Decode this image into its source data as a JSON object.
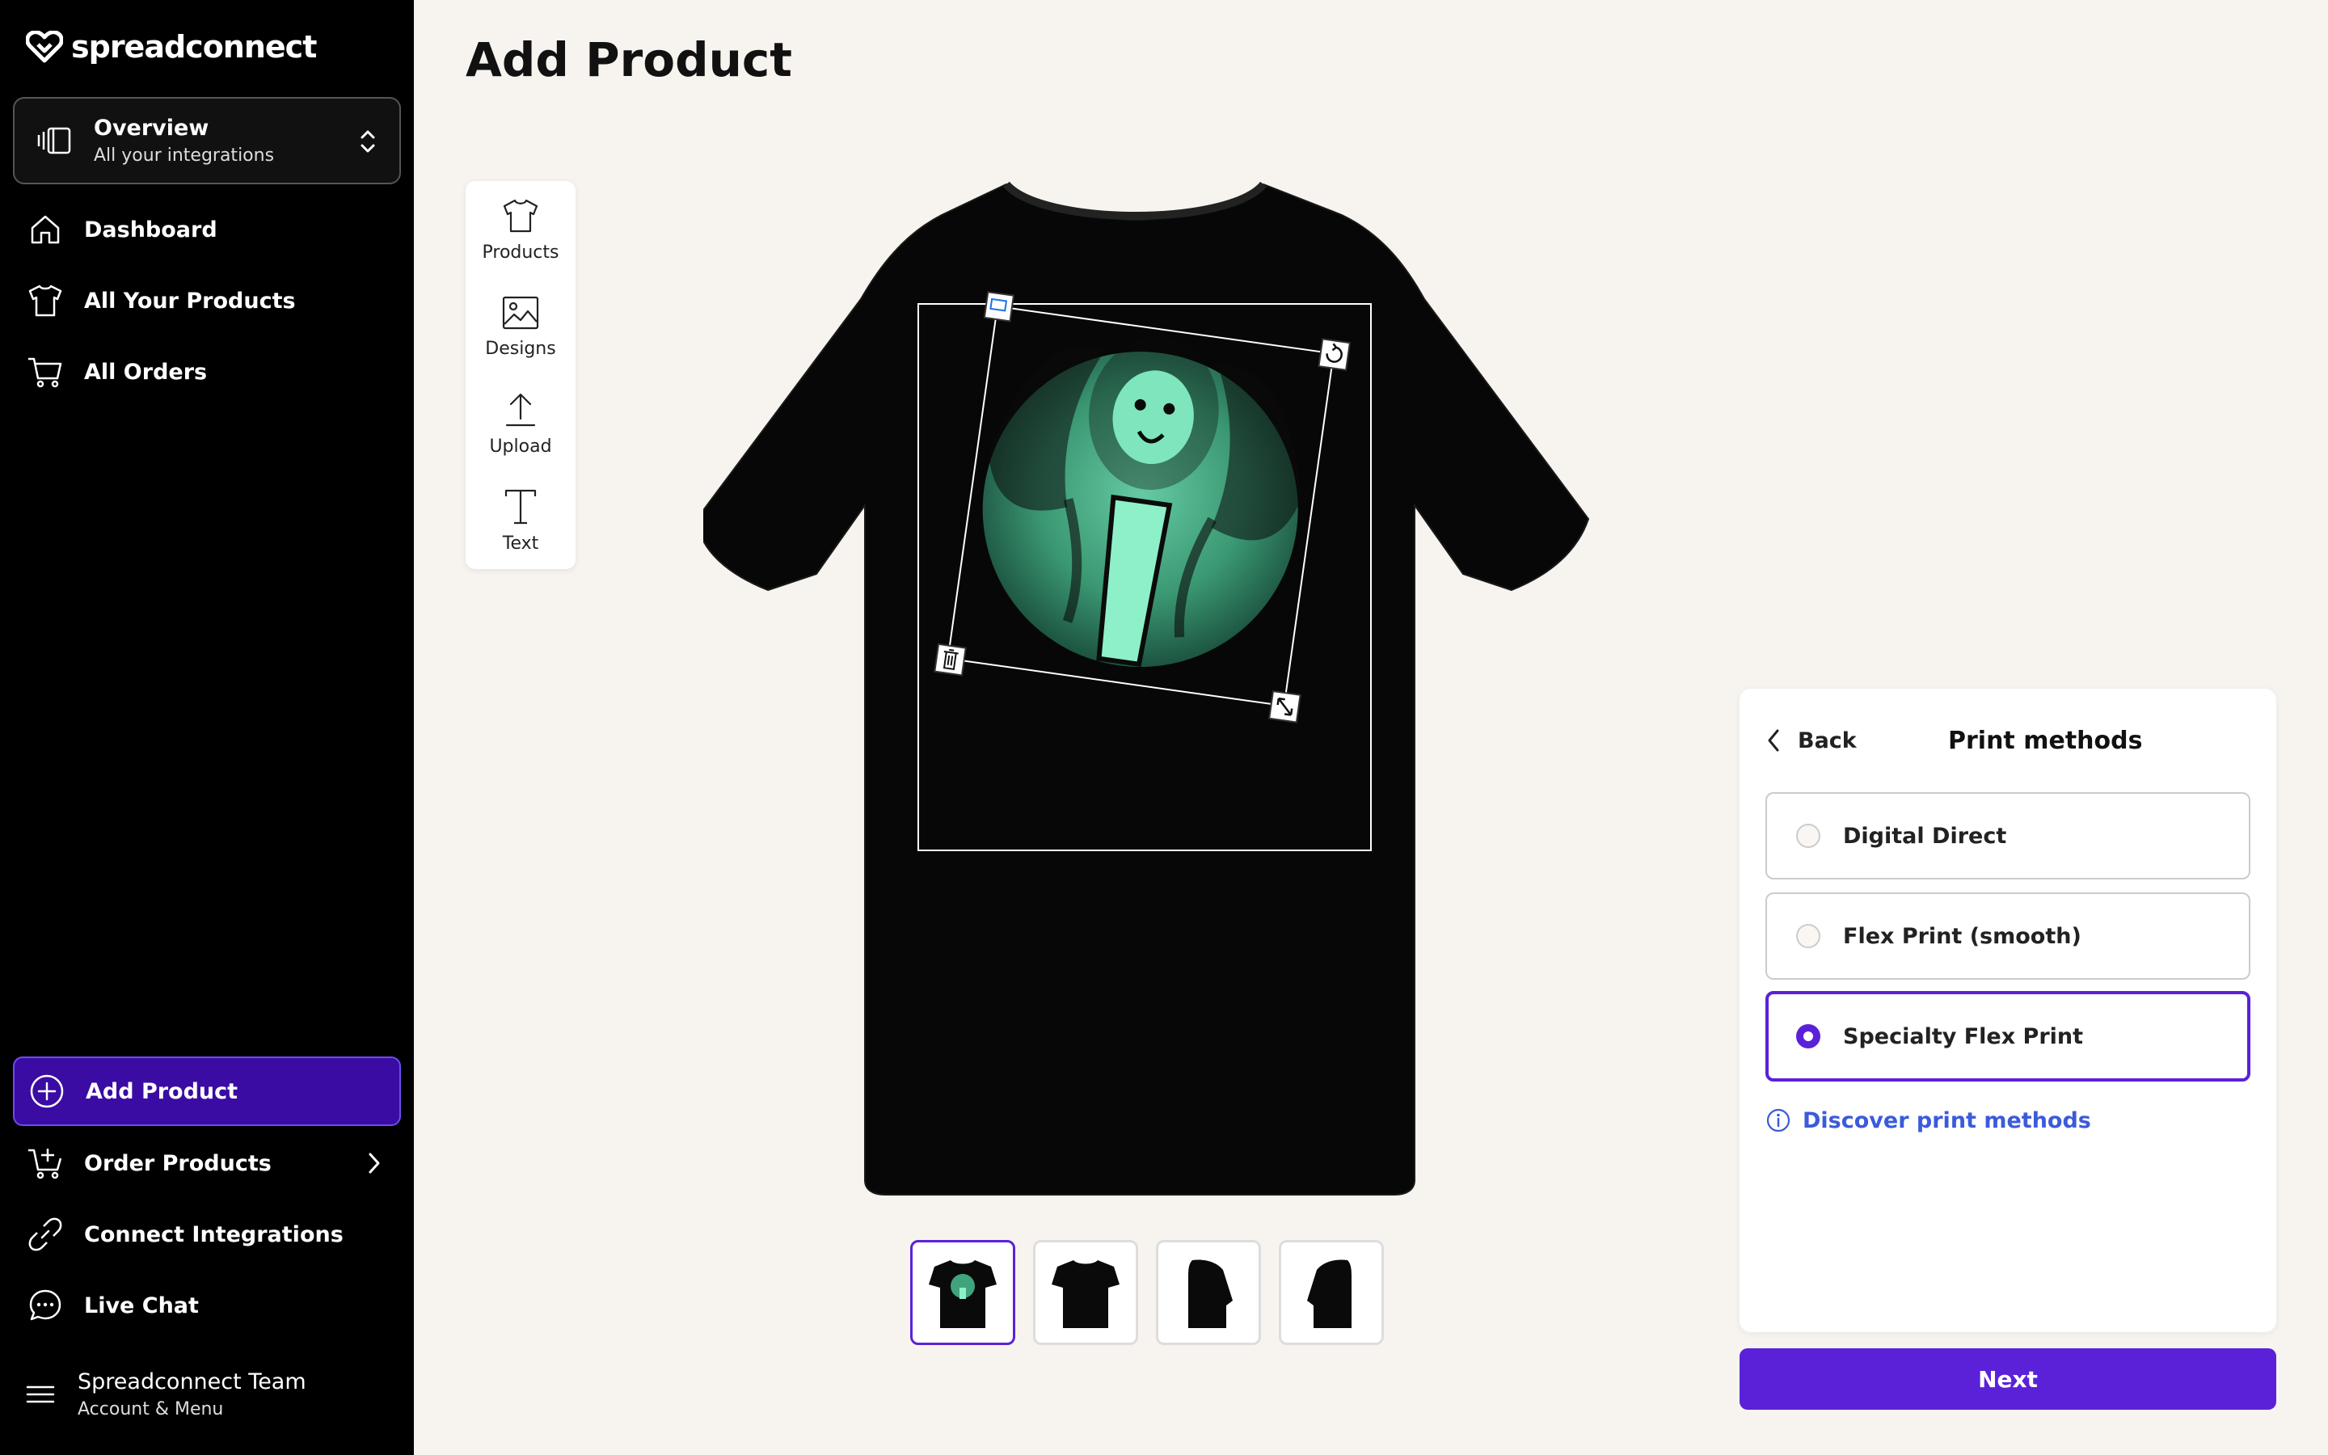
{
  "brand": {
    "name": "spreadconnect",
    "accent": "#5b21d9"
  },
  "switcher": {
    "title": "Overview",
    "subtitle": "All your integrations",
    "icon": "integrations-icon"
  },
  "nav_top": [
    {
      "label": "Dashboard",
      "icon": "home-icon"
    },
    {
      "label": "All Your Products",
      "icon": "tshirt-icon"
    },
    {
      "label": "All Orders",
      "icon": "cart-icon"
    }
  ],
  "nav_bottom": [
    {
      "label": "Add Product",
      "icon": "plus-circle-icon",
      "active": true
    },
    {
      "label": "Order Products",
      "icon": "cart-plus-icon"
    },
    {
      "label": "Connect Integrations",
      "icon": "link-icon"
    },
    {
      "label": "Live Chat",
      "icon": "chat-icon"
    }
  ],
  "account": {
    "name": "Spreadconnect Team",
    "subtitle": "Account & Menu",
    "icon": "menu-icon"
  },
  "page": {
    "title": "Add Product"
  },
  "tools": [
    {
      "label": "Products",
      "icon": "tshirt-icon"
    },
    {
      "label": "Designs",
      "icon": "image-icon"
    },
    {
      "label": "Upload",
      "icon": "upload-icon"
    },
    {
      "label": "Text",
      "icon": "text-icon"
    }
  ],
  "thumbnails": [
    {
      "view": "front-with-design",
      "selected": true
    },
    {
      "view": "front"
    },
    {
      "view": "left-side"
    },
    {
      "view": "right-side"
    }
  ],
  "print_panel": {
    "back_label": "Back",
    "title": "Print methods",
    "options": [
      {
        "label": "Digital Direct",
        "selected": false
      },
      {
        "label": "Flex Print (smooth)",
        "selected": false
      },
      {
        "label": "Specialty Flex Print",
        "selected": true
      }
    ],
    "discover_label": "Discover print methods"
  },
  "next_label": "Next"
}
